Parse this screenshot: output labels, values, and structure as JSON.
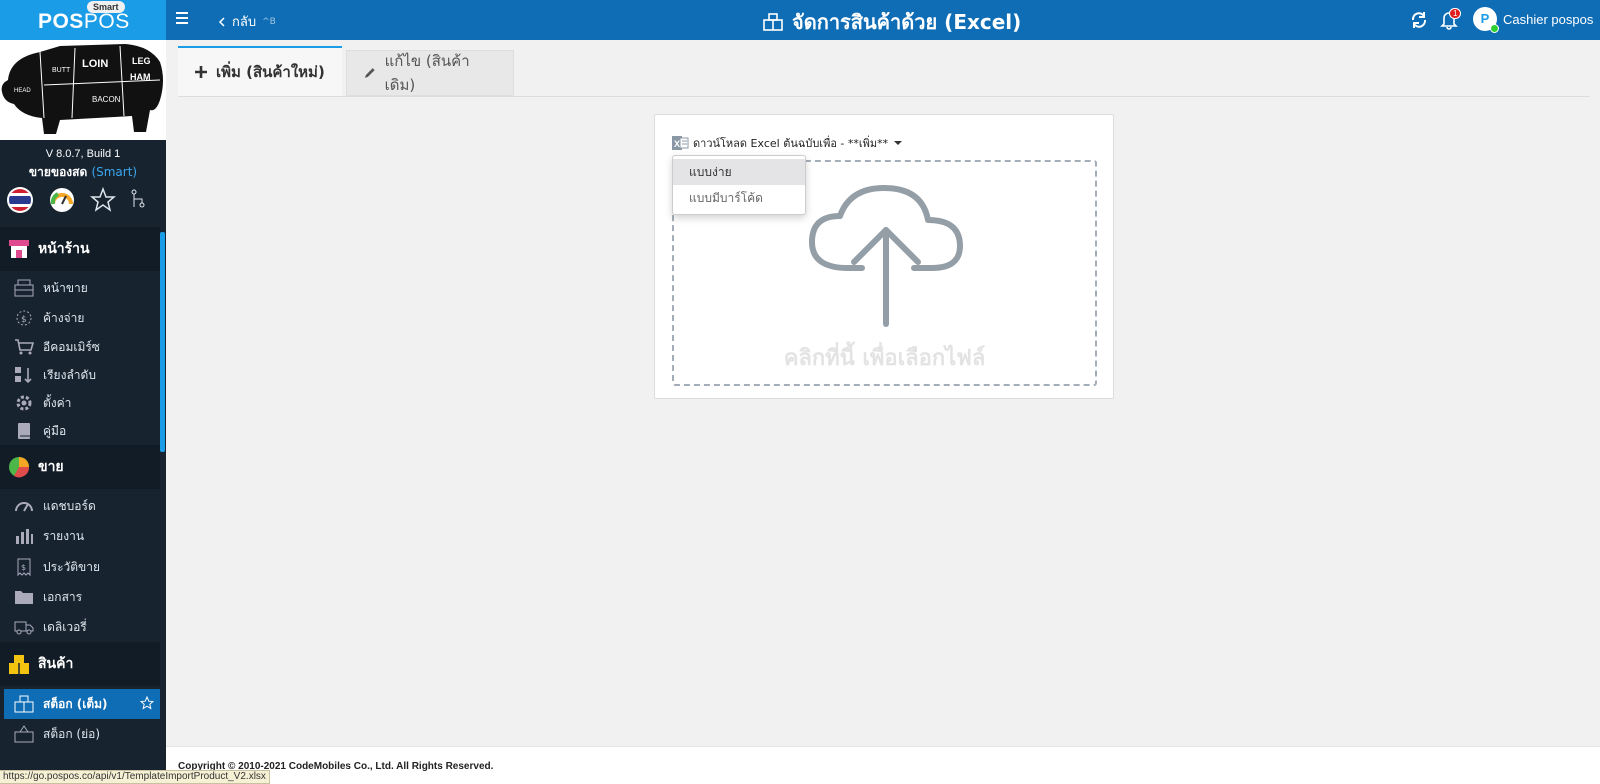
{
  "brand": {
    "logo_bold": "POS",
    "logo_thin": "POS",
    "badge": "Smart"
  },
  "header": {
    "back_label": "กลับ",
    "back_shortcut": "^B",
    "title": "จัดการสินค้าด้วย (Excel)",
    "notification_count": "1",
    "username": "Cashier pospos"
  },
  "sidebar": {
    "version": "V 8.0.7, Build 1",
    "store_name": "ขายของสด",
    "store_plan": "(Smart)",
    "sections": [
      {
        "title": "หน้าร้าน",
        "items": [
          "หน้าขาย",
          "ค้างจ่าย",
          "อีคอมเมิร์ซ",
          "เรียงลำดับ",
          "ตั้งค่า",
          "คู่มือ"
        ]
      },
      {
        "title": "ขาย",
        "items": [
          "แดชบอร์ด",
          "รายงาน",
          "ประวัติขาย",
          "เอกสาร",
          "เดลิเวอรี่"
        ]
      },
      {
        "title": "สินค้า",
        "items": [
          "สต็อก (เต็ม)",
          "สต็อก (ย่อ)"
        ]
      }
    ]
  },
  "tabs": {
    "add": "เพิ่ม (สินค้าใหม่)",
    "edit": "แก้ไข (สินค้าเดิม)"
  },
  "upload": {
    "download_label": "ดาวน์โหลด Excel ต้นฉบับเพื่อ - **เพิ่ม**",
    "dropzone_text": "คลิกที่นี้ เพื่อเลือกไฟล์",
    "dropdown_options": [
      "แบบง่าย",
      "แบบมีบาร์โค้ด"
    ]
  },
  "footer": {
    "copyright": "Copyright © 2010-2021 CodeMobiles Co., Ltd. All Rights Reserved.",
    "status_url": "https://go.pospos.co/api/v1/TemplateImportProduct_V2.xlsx"
  },
  "colors": {
    "topbar": "#0e6db5",
    "brand": "#1b9ce6",
    "sidebar": "#17232f",
    "accent": "#1b9ce6"
  }
}
